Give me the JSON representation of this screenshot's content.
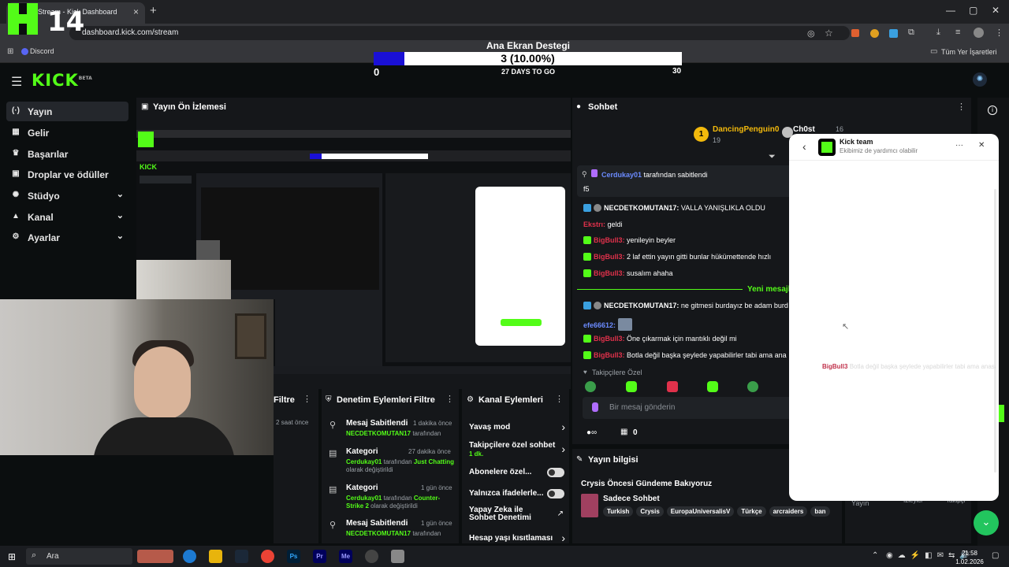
{
  "browser": {
    "tab_title": "Stream - Kick Dashboard",
    "tab_close": "×",
    "new_tab": "+",
    "url": "dashboard.kick.com/stream",
    "bookmark_discord": "Discord",
    "bookmark_all": "Tüm Yer İşaretleri",
    "minimize": "—",
    "maximize": "▢",
    "close": "✕"
  },
  "overlay": {
    "logo_text": "14",
    "goal_title": "Ana Ekran Destegi",
    "goal_value": "3 (10.00%)",
    "goal_progress": 0.1,
    "goal_min": "0",
    "goal_days": "27 DAYS TO GO",
    "goal_max": "30",
    "colors": {
      "kick_green": "#53fc18",
      "goal_fill": "#1a10d6"
    }
  },
  "dashboard": {
    "logo": "KICK",
    "logo_tag": "BETA"
  },
  "sidebar": {
    "items": [
      {
        "label": "Yayın",
        "icon": "broadcast-icon",
        "glyph": "(·)"
      },
      {
        "label": "Gelir",
        "icon": "chart-icon",
        "glyph": "▦"
      },
      {
        "label": "Başarılar",
        "icon": "trophy-icon",
        "glyph": "♛"
      },
      {
        "label": "Droplar ve ödüller",
        "icon": "gift-icon",
        "glyph": "▣"
      },
      {
        "label": "Stüdyo",
        "icon": "palette-icon",
        "glyph": "✺"
      },
      {
        "label": "Kanal",
        "icon": "channel-icon",
        "glyph": "▲"
      },
      {
        "label": "Ayarlar",
        "icon": "gear-icon",
        "glyph": "⚙"
      }
    ],
    "chevron": "⌄"
  },
  "preview": {
    "title": "Yayın Ön İzlemesi"
  },
  "mod_log": {
    "filter_label": "Filtre",
    "time_label": "2 saat önce"
  },
  "mod_actions": {
    "title": "Denetim Eylemleri",
    "filter": "Filtre",
    "items": [
      {
        "title": "Mesaj Sabitlendi",
        "time": "1 dakika önce",
        "user": "NECDETKOMUTAN17",
        "rest": "tarafından"
      },
      {
        "title": "Kategori",
        "time": "27 dakika önce",
        "user": "Cerdukay01",
        "rest": "tarafından",
        "target": "Just Chatting",
        "tail": "olarak değiştirildi"
      },
      {
        "title": "Kategori",
        "time": "1 gün önce",
        "user": "Cerdukay01",
        "rest": "tarafından",
        "target": "Counter-Strike 2",
        "tail": "olarak değiştirildi"
      },
      {
        "title": "Mesaj Sabitlendi",
        "time": "1 gün önce",
        "user": "NECDETKOMUTAN17",
        "rest": "tarafından"
      }
    ]
  },
  "channel_actions": {
    "title": "Kanal Eylemleri",
    "items": [
      {
        "label": "Yavaş mod",
        "kind": "chevron"
      },
      {
        "label": "Takipçilere özel sohbet",
        "sub": "1 dk.",
        "kind": "chevron"
      },
      {
        "label": "Abonelere özel...",
        "kind": "toggle"
      },
      {
        "label": "Yalnızca ifadelerle...",
        "kind": "toggle"
      },
      {
        "label": "Yapay Zeka ile Sohbet Denetimi",
        "kind": "external"
      },
      {
        "label": "Hesap yaşı kısıtlaması",
        "kind": "chevron"
      }
    ]
  },
  "chat": {
    "title": "Sohbet",
    "top_user_1": "DancingPenguin0",
    "top_user_1_count": "19",
    "top_user_2": "Ch0st",
    "top_user_2_count": "16",
    "pinned_by": "Cerdukay01",
    "pinned_suffix": "tarafından sabitlendi",
    "pinned_message": "f5",
    "messages": [
      {
        "user": "NECDETKOMUTAN17:",
        "text": "VALLA YANIŞLIKLA OLDU",
        "style": "u-white"
      },
      {
        "user": "Ekstrı:",
        "text": "geldi",
        "style": "u-red"
      },
      {
        "user": "BigBull3:",
        "text": "yenileyin beyler",
        "style": "u-red"
      },
      {
        "user": "BigBull3:",
        "text": "2 laf ettin yayın gitti bunlar hükümettende hızlı",
        "style": "u-red"
      },
      {
        "user": "BigBull3:",
        "text": "susalım ahaha",
        "style": "u-red"
      },
      {
        "user": "NECDETKOMUTAN17:",
        "text": "ne gitmesi burdayız be adam burd",
        "style": "u-white"
      },
      {
        "user": "efe66612:",
        "text": "",
        "style": "u-blue"
      },
      {
        "user": "BigBull3:",
        "text": "Öne çıkarmak için mantıklı değil mi",
        "style": "u-red"
      },
      {
        "user": "BigBull3:",
        "text": "Botla değil başka şeylede yapabilirler tabi ama ana",
        "style": "u-red"
      }
    ],
    "new_messages": "Yeni mesajl",
    "followers_only": "Takipçilere Özel",
    "input_placeholder": "Bir mesaj gönderin",
    "points": "0"
  },
  "stream_info": {
    "title": "Yayın bilgisi",
    "stream_title": "Crysis Öncesi Gündeme Bakıyoruz",
    "category": "Sadece Sohbet",
    "tags": [
      "Turkish",
      "Crysis",
      "EuropaUniversalisV",
      "Türkçe",
      "arcraiders",
      "ban"
    ]
  },
  "popup": {
    "title": "Kick team",
    "subtitle": "Ekibimiz de yardımcı olabilir",
    "back": "‹",
    "more": "···",
    "close": "✕",
    "ghost_user": "BigBull3",
    "ghost_text": "Botla değil başka şeylede yapabilirler tabi ama anasayfada görsel gelen önde iyi",
    "bg_tabs": [
      "Yayın",
      "İzleyici",
      "Takipçi"
    ]
  },
  "taskbar": {
    "search": "Ara",
    "time": "21:58",
    "date": "1.02.2026"
  }
}
